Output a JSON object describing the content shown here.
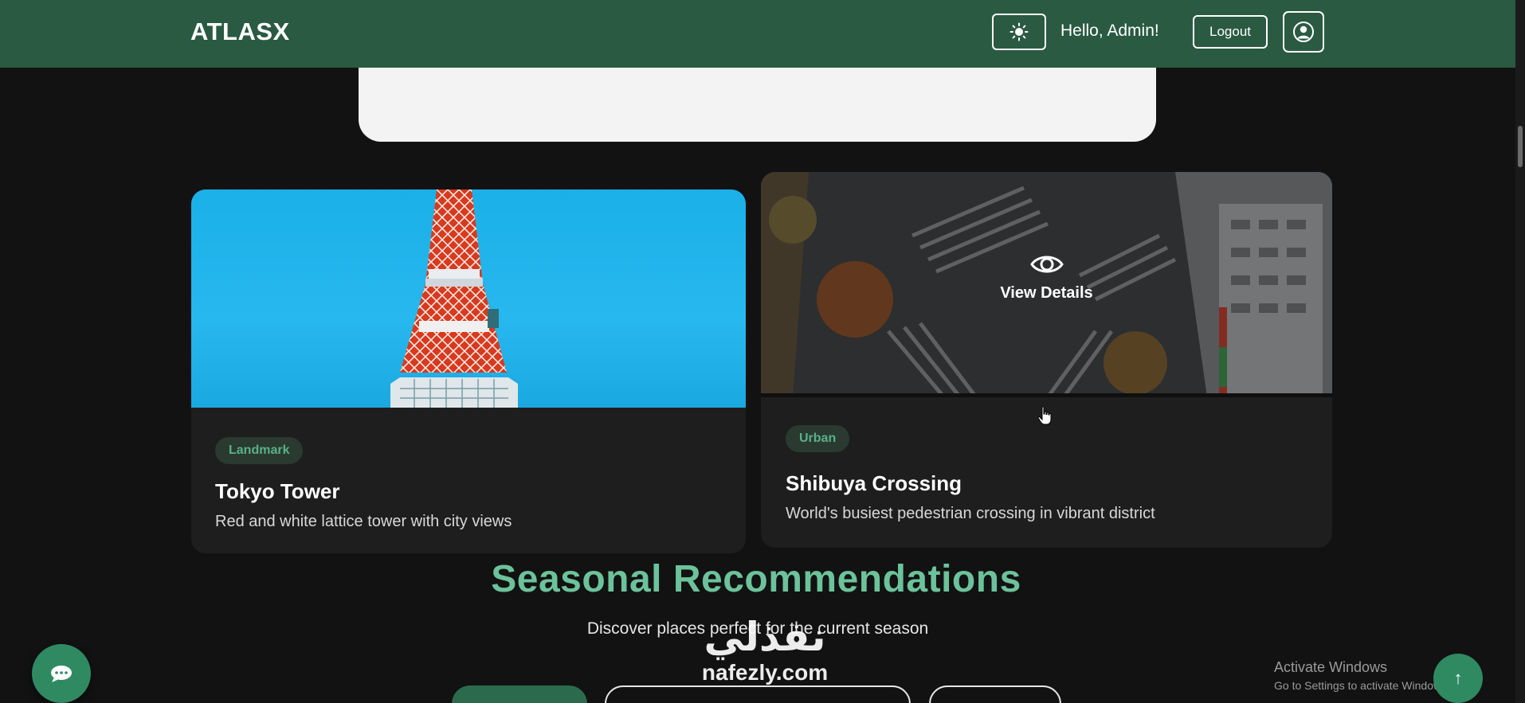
{
  "navbar": {
    "brand": "ATLASX",
    "theme_icon": "sun-icon",
    "greeting": "Hello, Admin!",
    "logout_label": "Logout",
    "profile_icon": "user-circle-icon",
    "background": "#2a5a42"
  },
  "cards": [
    {
      "tag": "Landmark",
      "title": "Tokyo Tower",
      "description": "Red and white lattice tower with city views"
    },
    {
      "tag": "Urban",
      "title": "Shibuya Crossing",
      "description": "World's busiest pedestrian crossing in vibrant district",
      "overlay_icon": "eye-icon",
      "overlay_label": "View Details"
    }
  ],
  "seasonal": {
    "title": "Seasonal Recommendations",
    "subtitle": "Discover places perfect for the current season"
  },
  "floating": {
    "chat_icon": "chat-bubble-icon",
    "scroll_top_label": "↑"
  },
  "windows_notice": {
    "title": "Activate Windows",
    "subtitle": "Go to Settings to activate Windows."
  },
  "watermark": {
    "arabic": "نفذلي",
    "latin": "nafezly.com"
  },
  "colors": {
    "accent": "#6cc29b",
    "tag_text": "#59b088",
    "page_bg": "#121212",
    "card_bg": "#1e1e1e"
  }
}
